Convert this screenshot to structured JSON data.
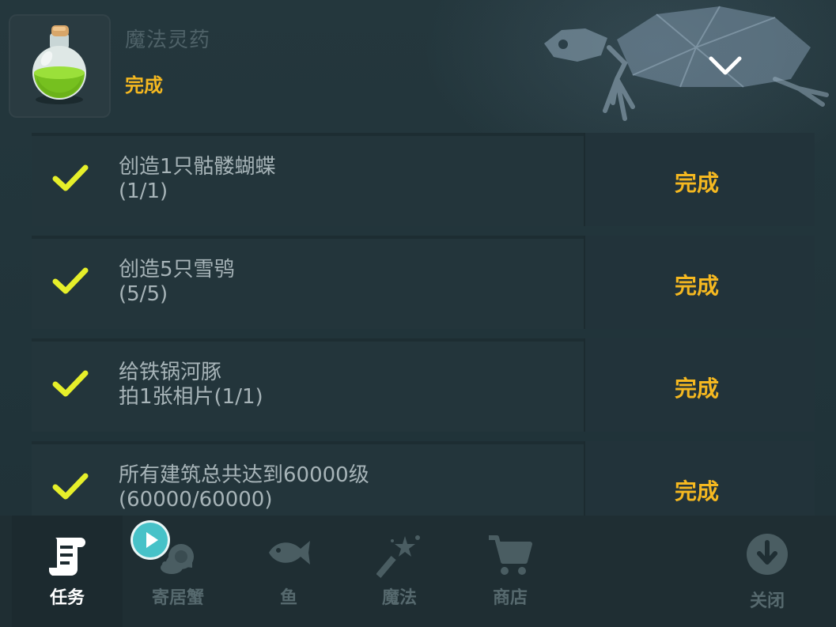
{
  "quest": {
    "title": "魔法灵药",
    "status": "完成",
    "icon": "potion-icon"
  },
  "tasks": [
    {
      "line1": "创造1只骷髅蝴蝶",
      "line2": "(1/1)",
      "status": "完成",
      "progress": 1.0
    },
    {
      "line1": "创造5只雪鸮",
      "line2": "(5/5)",
      "status": "完成",
      "progress": 1.0
    },
    {
      "line1": "给铁锅河豚",
      "line2": "拍1张相片(1/1)",
      "status": "完成",
      "progress": 1.0
    },
    {
      "line1": "所有建筑总共达到60000级",
      "line2": "(60000/60000)",
      "status": "完成",
      "progress": 1.0
    }
  ],
  "tabs": [
    {
      "label": "任务",
      "icon": "scroll-icon",
      "active": true
    },
    {
      "label": "寄居蟹",
      "icon": "hermit-crab-icon",
      "active": false
    },
    {
      "label": "鱼",
      "icon": "fish-icon",
      "active": false
    },
    {
      "label": "魔法",
      "icon": "magic-wand-icon",
      "active": false
    },
    {
      "label": "商店",
      "icon": "cart-icon",
      "active": false
    },
    {
      "label": "关闭",
      "icon": "close-arrow-icon",
      "active": false
    }
  ],
  "colors": {
    "accent": "#f5b820",
    "check": "#e6ef2a",
    "background": "#22343a"
  }
}
